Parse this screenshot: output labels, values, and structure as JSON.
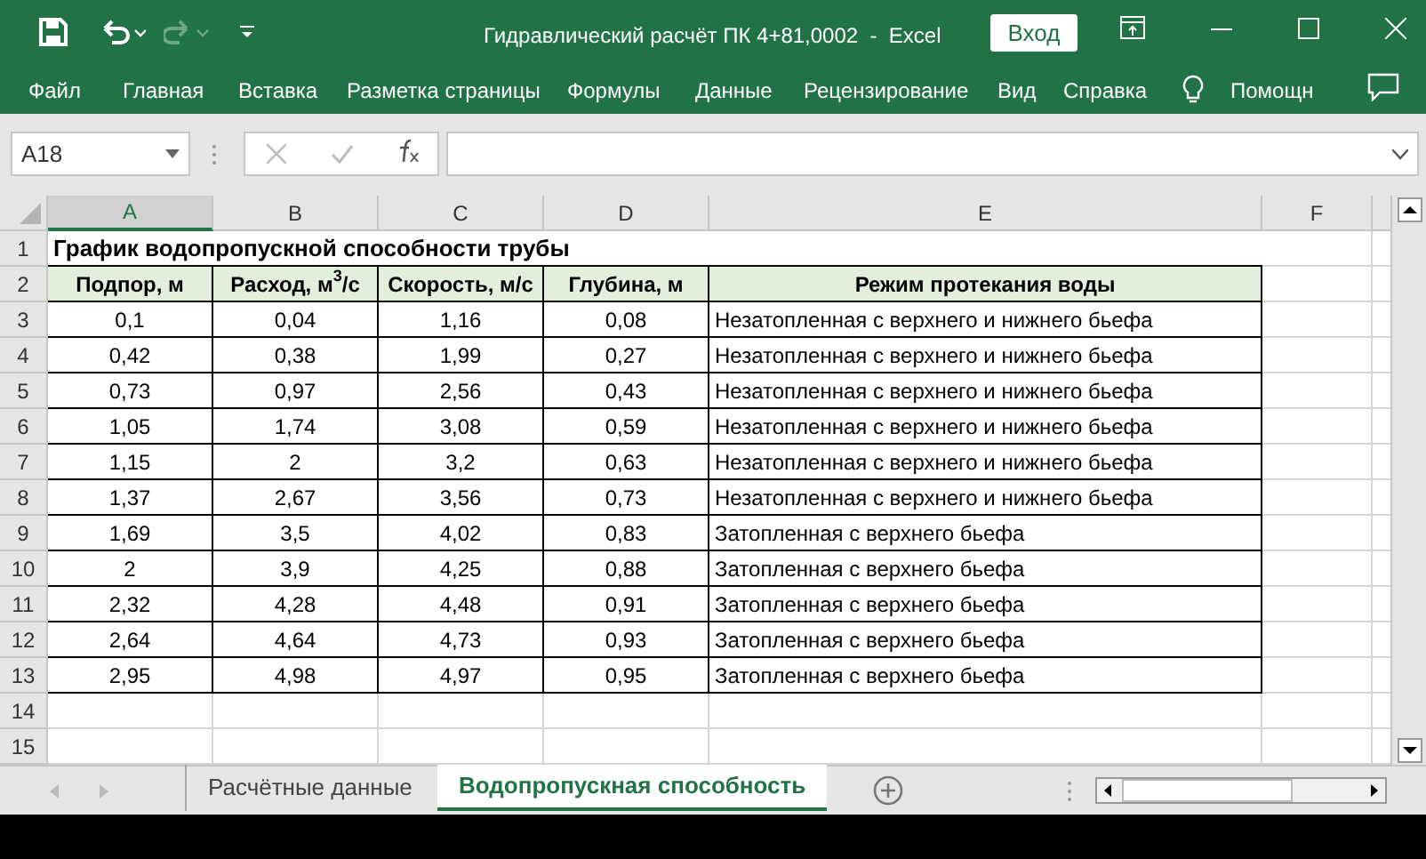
{
  "window": {
    "title": "Гидравлический расчёт ПК 4+81,0002  -  Excel",
    "login_button": "Вход"
  },
  "ribbon": {
    "tabs": [
      "Файл",
      "Главная",
      "Вставка",
      "Разметка страницы",
      "Формулы",
      "Данные",
      "Рецензирование",
      "Вид",
      "Справка"
    ],
    "tell_me": "Помощн"
  },
  "formula_bar": {
    "name_box": "A18"
  },
  "sheet": {
    "columns": [
      {
        "label": "A",
        "selected": true
      },
      {
        "label": "B",
        "selected": false
      },
      {
        "label": "C",
        "selected": false
      },
      {
        "label": "D",
        "selected": false
      },
      {
        "label": "E",
        "selected": false
      },
      {
        "label": "F",
        "selected": false
      }
    ],
    "title_row": {
      "number": "1",
      "text": "График водопропускной способности трубы"
    },
    "header_row": {
      "number": "2",
      "cells": [
        "Подпор, м",
        "Расход, м$^{3}$/с",
        "Скорость, м/с",
        "Глубина, м",
        "Режим протекания воды"
      ]
    },
    "data_rows": [
      {
        "number": "3",
        "cells": [
          "0,1",
          "0,04",
          "1,16",
          "0,08",
          "Незатопленная с верхнего и нижнего бьефа"
        ]
      },
      {
        "number": "4",
        "cells": [
          "0,42",
          "0,38",
          "1,99",
          "0,27",
          "Незатопленная с верхнего и нижнего бьефа"
        ]
      },
      {
        "number": "5",
        "cells": [
          "0,73",
          "0,97",
          "2,56",
          "0,43",
          "Незатопленная с верхнего и нижнего бьефа"
        ]
      },
      {
        "number": "6",
        "cells": [
          "1,05",
          "1,74",
          "3,08",
          "0,59",
          "Незатопленная с верхнего и нижнего бьефа"
        ]
      },
      {
        "number": "7",
        "cells": [
          "1,15",
          "2",
          "3,2",
          "0,63",
          "Незатопленная с верхнего и нижнего бьефа"
        ]
      },
      {
        "number": "8",
        "cells": [
          "1,37",
          "2,67",
          "3,56",
          "0,73",
          "Незатопленная с верхнего и нижнего бьефа"
        ]
      },
      {
        "number": "9",
        "cells": [
          "1,69",
          "3,5",
          "4,02",
          "0,83",
          "Затопленная с верхнего бьефа"
        ]
      },
      {
        "number": "10",
        "cells": [
          "2",
          "3,9",
          "4,25",
          "0,88",
          "Затопленная с верхнего бьефа"
        ]
      },
      {
        "number": "11",
        "cells": [
          "2,32",
          "4,28",
          "4,48",
          "0,91",
          "Затопленная с верхнего бьефа"
        ]
      },
      {
        "number": "12",
        "cells": [
          "2,64",
          "4,64",
          "4,73",
          "0,93",
          "Затопленная с верхнего бьефа"
        ]
      },
      {
        "number": "13",
        "cells": [
          "2,95",
          "4,98",
          "4,97",
          "0,95",
          "Затопленная с верхнего бьефа"
        ]
      }
    ],
    "empty_rows": [
      {
        "number": "14"
      },
      {
        "number": "15"
      }
    ]
  },
  "sheet_tabs": [
    {
      "label": "Расчётные данные",
      "selected": false
    },
    {
      "label": "Водопропускная способность",
      "selected": true
    }
  ]
}
